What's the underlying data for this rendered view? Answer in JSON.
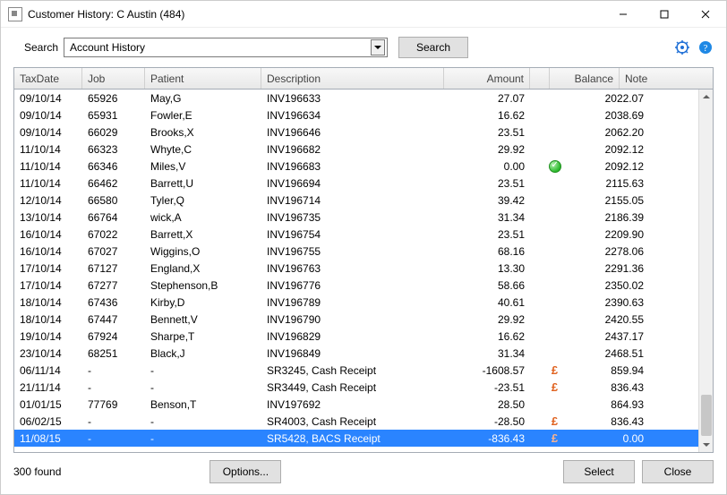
{
  "window": {
    "title": "Customer History: C Austin (484)"
  },
  "search": {
    "label": "Search",
    "combo_value": "Account History",
    "button": "Search"
  },
  "icons": {
    "gear": "settings",
    "help": "help"
  },
  "columns": {
    "taxdate": "TaxDate",
    "job": "Job",
    "patient": "Patient",
    "description": "Description",
    "amount": "Amount",
    "balance": "Balance",
    "note": "Note"
  },
  "rows": [
    {
      "taxdate": "09/10/14",
      "job": "65926",
      "patient": "May,G",
      "description": "INV196633",
      "amount": "27.07",
      "balance": "2022.07",
      "status": "",
      "selected": false
    },
    {
      "taxdate": "09/10/14",
      "job": "65931",
      "patient": "Fowler,E",
      "description": "INV196634",
      "amount": "16.62",
      "balance": "2038.69",
      "status": "",
      "selected": false
    },
    {
      "taxdate": "09/10/14",
      "job": "66029",
      "patient": "Brooks,X",
      "description": "INV196646",
      "amount": "23.51",
      "balance": "2062.20",
      "status": "",
      "selected": false
    },
    {
      "taxdate": "11/10/14",
      "job": "66323",
      "patient": "Whyte,C",
      "description": "INV196682",
      "amount": "29.92",
      "balance": "2092.12",
      "status": "",
      "selected": false
    },
    {
      "taxdate": "11/10/14",
      "job": "66346",
      "patient": "Miles,V",
      "description": "INV196683",
      "amount": "0.00",
      "balance": "2092.12",
      "status": "ok",
      "selected": false
    },
    {
      "taxdate": "11/10/14",
      "job": "66462",
      "patient": "Barrett,U",
      "description": "INV196694",
      "amount": "23.51",
      "balance": "2115.63",
      "status": "",
      "selected": false
    },
    {
      "taxdate": "12/10/14",
      "job": "66580",
      "patient": "Tyler,Q",
      "description": "INV196714",
      "amount": "39.42",
      "balance": "2155.05",
      "status": "",
      "selected": false
    },
    {
      "taxdate": "13/10/14",
      "job": "66764",
      "patient": "wick,A",
      "description": "INV196735",
      "amount": "31.34",
      "balance": "2186.39",
      "status": "",
      "selected": false
    },
    {
      "taxdate": "16/10/14",
      "job": "67022",
      "patient": "Barrett,X",
      "description": "INV196754",
      "amount": "23.51",
      "balance": "2209.90",
      "status": "",
      "selected": false
    },
    {
      "taxdate": "16/10/14",
      "job": "67027",
      "patient": "Wiggins,O",
      "description": "INV196755",
      "amount": "68.16",
      "balance": "2278.06",
      "status": "",
      "selected": false
    },
    {
      "taxdate": "17/10/14",
      "job": "67127",
      "patient": "England,X",
      "description": "INV196763",
      "amount": "13.30",
      "balance": "2291.36",
      "status": "",
      "selected": false
    },
    {
      "taxdate": "17/10/14",
      "job": "67277",
      "patient": "Stephenson,B",
      "description": "INV196776",
      "amount": "58.66",
      "balance": "2350.02",
      "status": "",
      "selected": false
    },
    {
      "taxdate": "18/10/14",
      "job": "67436",
      "patient": "Kirby,D",
      "description": "INV196789",
      "amount": "40.61",
      "balance": "2390.63",
      "status": "",
      "selected": false
    },
    {
      "taxdate": "18/10/14",
      "job": "67447",
      "patient": "Bennett,V",
      "description": "INV196790",
      "amount": "29.92",
      "balance": "2420.55",
      "status": "",
      "selected": false
    },
    {
      "taxdate": "19/10/14",
      "job": "67924",
      "patient": "Sharpe,T",
      "description": "INV196829",
      "amount": "16.62",
      "balance": "2437.17",
      "status": "",
      "selected": false
    },
    {
      "taxdate": "23/10/14",
      "job": "68251",
      "patient": "Black,J",
      "description": "INV196849",
      "amount": "31.34",
      "balance": "2468.51",
      "status": "",
      "selected": false
    },
    {
      "taxdate": "06/11/14",
      "job": "-",
      "patient": "-",
      "description": "SR3245, Cash Receipt",
      "amount": "-1608.57",
      "balance": "859.94",
      "status": "gbp",
      "selected": false
    },
    {
      "taxdate": "21/11/14",
      "job": "-",
      "patient": "-",
      "description": "SR3449, Cash Receipt",
      "amount": "-23.51",
      "balance": "836.43",
      "status": "gbp",
      "selected": false
    },
    {
      "taxdate": "01/01/15",
      "job": "77769",
      "patient": "Benson,T",
      "description": "INV197692",
      "amount": "28.50",
      "balance": "864.93",
      "status": "",
      "selected": false
    },
    {
      "taxdate": "06/02/15",
      "job": "-",
      "patient": "-",
      "description": "SR4003, Cash Receipt",
      "amount": "-28.50",
      "balance": "836.43",
      "status": "gbp",
      "selected": false
    },
    {
      "taxdate": "11/08/15",
      "job": "-",
      "patient": "-",
      "description": "SR5428, BACS Receipt",
      "amount": "-836.43",
      "balance": "0.00",
      "status": "gbp",
      "selected": true
    }
  ],
  "footer": {
    "found": "300  found",
    "options": "Options...",
    "select": "Select",
    "close": "Close"
  }
}
